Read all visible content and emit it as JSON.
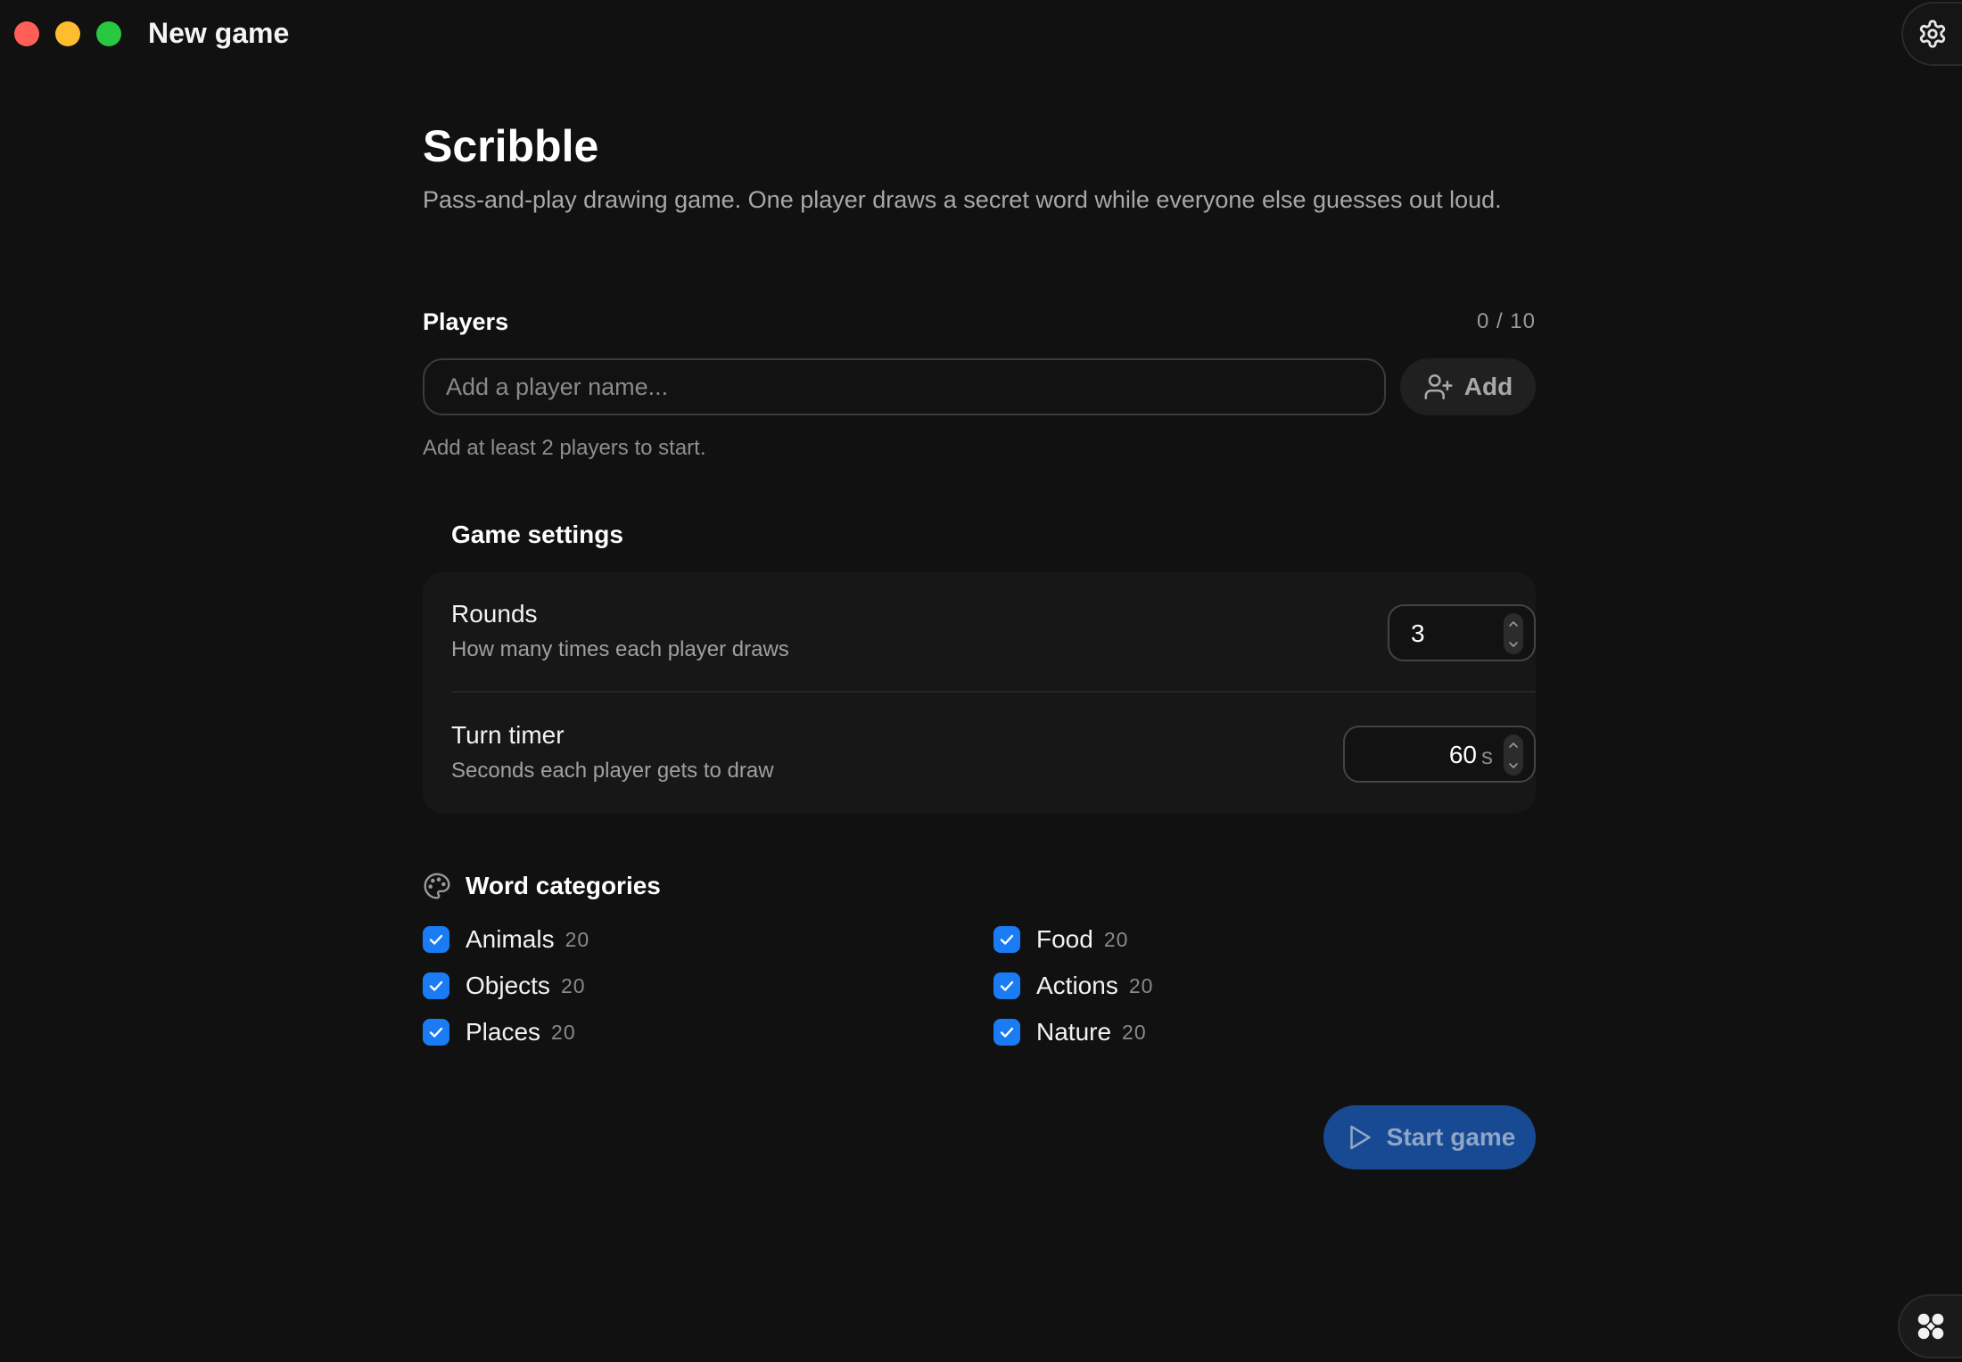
{
  "window": {
    "title": "New game"
  },
  "page": {
    "title": "Scribble",
    "description": "Pass-and-play drawing game. One player draws a secret word while everyone else guesses out loud."
  },
  "players": {
    "label": "Players",
    "count": "0 / 10",
    "input_placeholder": "Add a player name...",
    "add_label": "Add",
    "hint": "Add at least 2 players to start."
  },
  "settings": {
    "heading": "Game settings",
    "rounds": {
      "label": "Rounds",
      "description": "How many times each player draws",
      "value": "3"
    },
    "timer": {
      "label": "Turn timer",
      "description": "Seconds each player gets to draw",
      "value": "60",
      "unit": "s"
    }
  },
  "categories": {
    "heading": "Word categories",
    "items": [
      {
        "name": "Animals",
        "count": "20",
        "checked": true
      },
      {
        "name": "Food",
        "count": "20",
        "checked": true
      },
      {
        "name": "Objects",
        "count": "20",
        "checked": true
      },
      {
        "name": "Actions",
        "count": "20",
        "checked": true
      },
      {
        "name": "Places",
        "count": "20",
        "checked": true
      },
      {
        "name": "Nature",
        "count": "20",
        "checked": true
      }
    ]
  },
  "actions": {
    "start_label": "Start game"
  },
  "colors": {
    "accent": "#1a7cf5",
    "start_button": "#174a93",
    "background": "#111111"
  }
}
